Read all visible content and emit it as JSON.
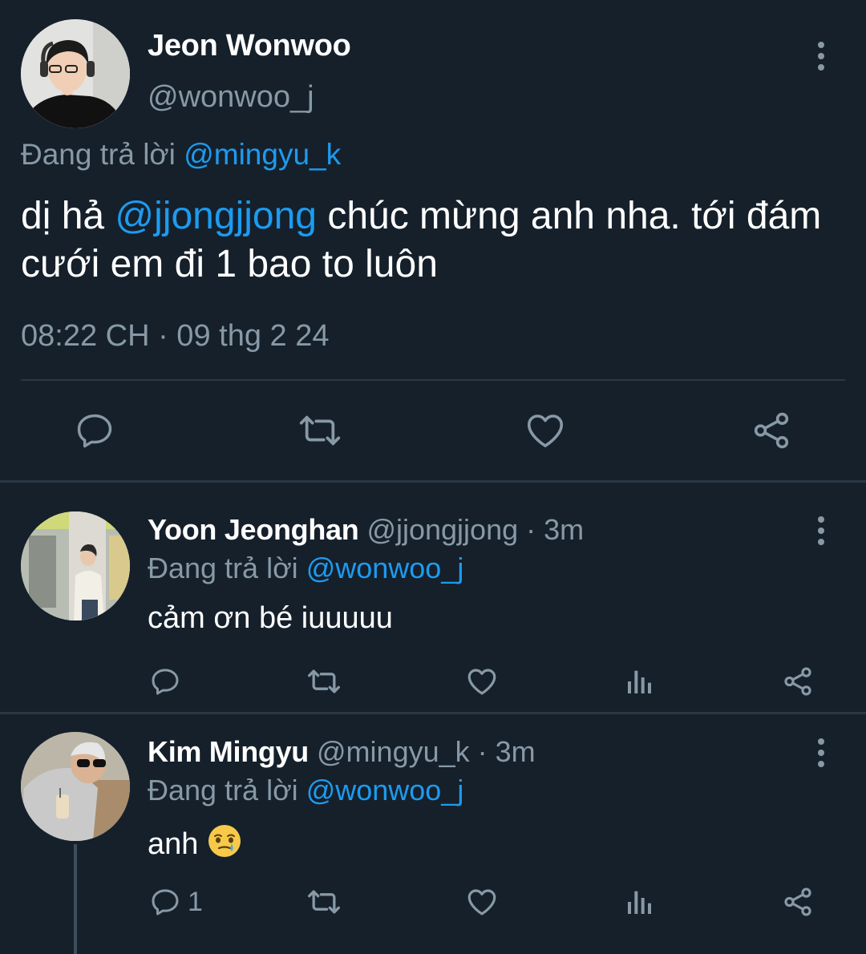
{
  "main_tweet": {
    "author_name": "Jeon Wonwoo",
    "author_handle": "@wonwoo_j",
    "replying_label": "Đang trả lời",
    "replying_to": "@mingyu_k",
    "text_before": "dị hả ",
    "mention": "@jjongjjong",
    "text_after": " chúc mừng anh nha. tới đám cưới em đi 1 bao to luôn",
    "timestamp": "08:22 CH · 09 thg 2 24"
  },
  "replies": [
    {
      "author_name": "Yoon Jeonghan",
      "author_handle": "@jjongjjong",
      "time": " · 3m",
      "replying_label": "Đang trả lời",
      "replying_to": "@wonwoo_j",
      "text": "cảm ơn bé iuuuuu",
      "reply_count": ""
    },
    {
      "author_name": "Kim Mingyu",
      "author_handle": "@mingyu_k",
      "time": " · 3m",
      "replying_label": "Đang trả lời",
      "replying_to": "@wonwoo_j",
      "text": "anh",
      "emoji": "face-holding-back-tears",
      "reply_count": "1"
    }
  ],
  "colors": {
    "background": "#15202b",
    "link": "#1d9bf0",
    "secondary_text": "#8899a6",
    "divider": "#2a3845"
  }
}
